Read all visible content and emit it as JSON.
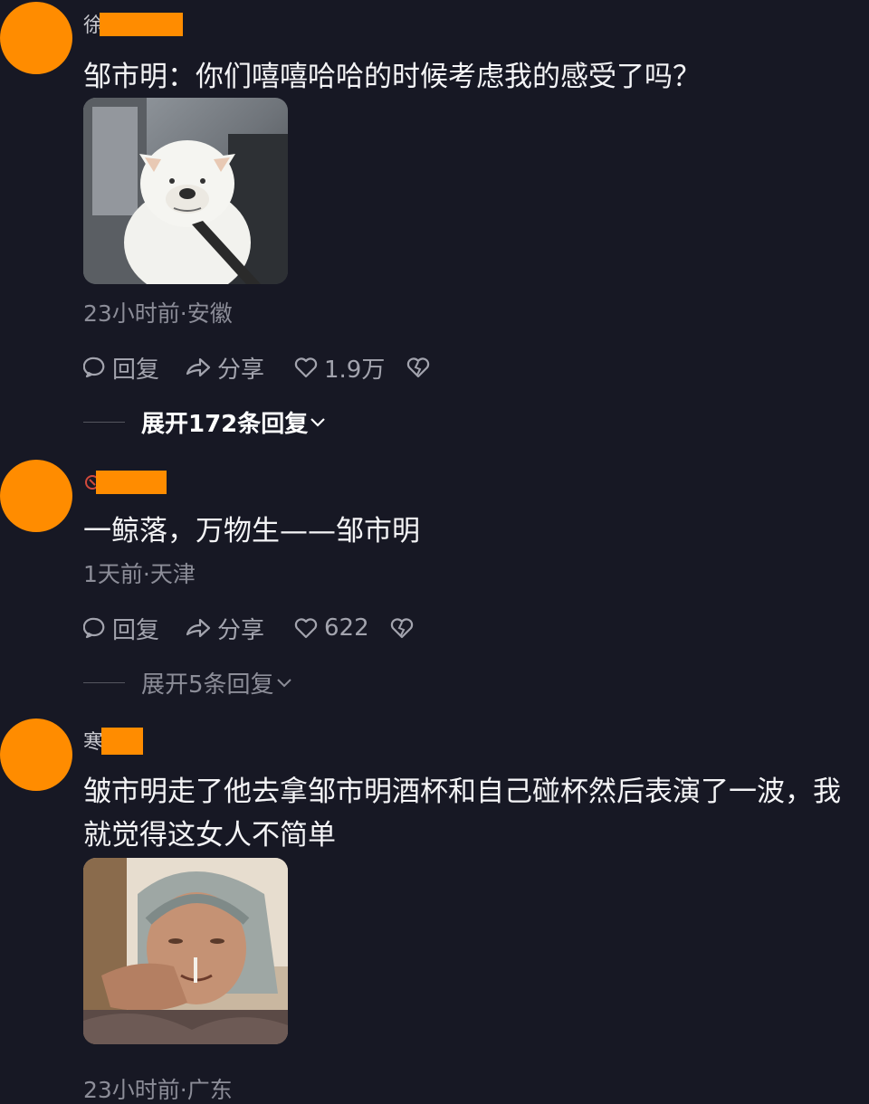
{
  "colors": {
    "background": "#171824",
    "avatar": "#ff8c00",
    "text": "#f4f4f6",
    "meta": "#8c8d98",
    "action": "#a3a4ae",
    "expand_active": "#ffffff",
    "expand_muted": "#8c8d98"
  },
  "comments": [
    {
      "name_fragment": "徐",
      "text": "邹市明：你们嘻嘻哈哈的时候考虑我的感受了吗？",
      "image": "white dog meme in car seat",
      "meta": "23小时前·安徽",
      "reply_label": "回复",
      "share_label": "分享",
      "likes": "1.9万",
      "expand_label": "展开172条回复"
    },
    {
      "name_fragment": "",
      "text": "一鲸落，万物生——邹市明",
      "meta": "1天前·天津",
      "reply_label": "回复",
      "share_label": "分享",
      "likes": "622",
      "expand_label": "展开5条回复"
    },
    {
      "name_fragment": "寒",
      "text_line1": "皱市明走了他去拿邹市明酒杯和自己碰杯然后表演了一波，我",
      "text_line2": "就觉得这女人不简单",
      "image": "elderly woman smoking meme",
      "meta": "23小时前·广东"
    }
  ]
}
